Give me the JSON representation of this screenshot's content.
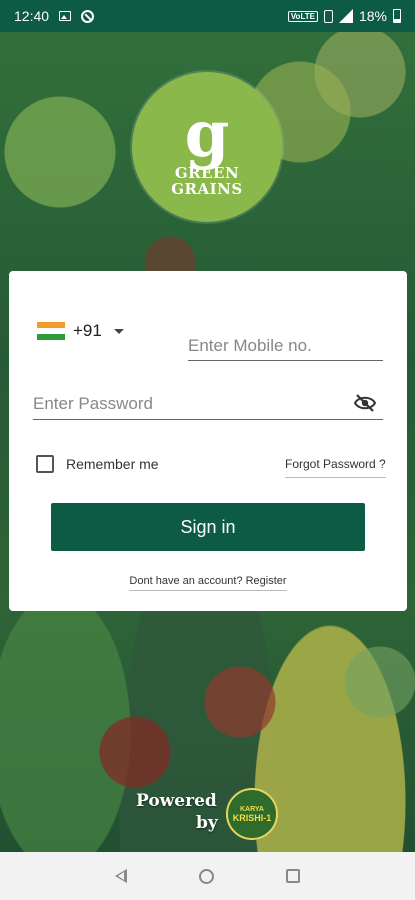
{
  "status_bar": {
    "time": "12:40",
    "network_badge": "VoLTE",
    "battery_percent": "18%",
    "icons": [
      "image-icon",
      "blocked-circle-icon",
      "vibrate-icon",
      "signal-icon",
      "battery-icon"
    ]
  },
  "logo": {
    "mark": "g",
    "line1": "GREEN",
    "line2": "GRAINS",
    "color": "#8ab84a"
  },
  "login": {
    "country_code": "+91",
    "flag": "india-flag-icon",
    "mobile_placeholder": "Enter Mobile no.",
    "password_placeholder": "Enter Password",
    "remember_label": "Remember me",
    "remember_checked": false,
    "forgot_label": "Forgot Password ?",
    "signin_label": "Sign in",
    "register_label": "Dont have an account? Register"
  },
  "footer": {
    "powered_line1": "Powered",
    "powered_line2": "by",
    "partner_small": "KARYA",
    "partner_main": "KRISHI-1"
  },
  "colors": {
    "primary": "#0d5a45",
    "logo": "#8ab84a"
  }
}
